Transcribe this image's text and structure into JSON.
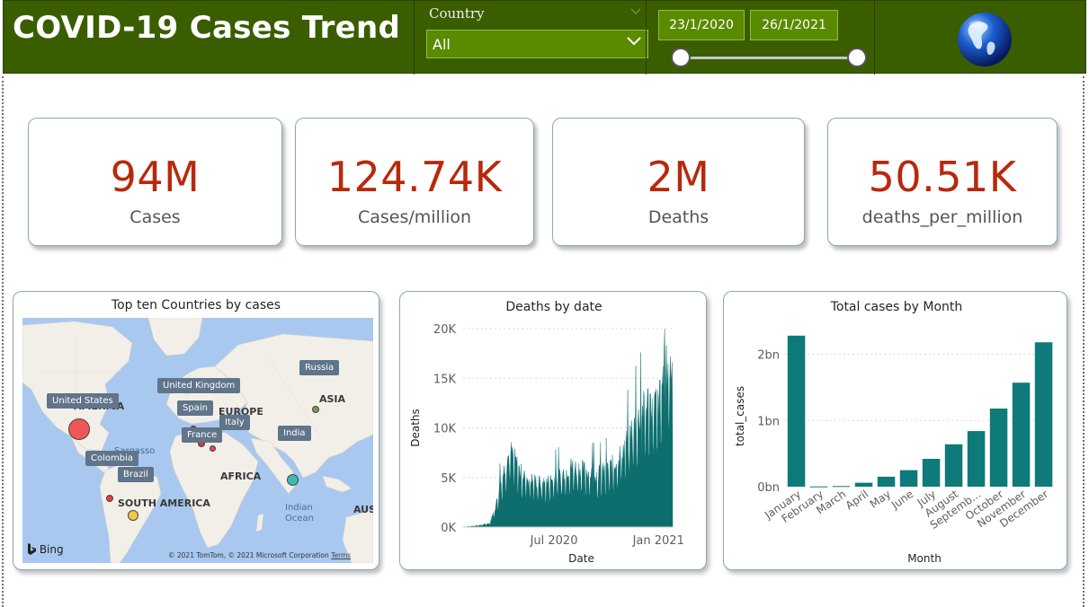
{
  "header": {
    "title": "COVID-19 Cases Trend",
    "country_filter_label": "Country",
    "country_selected": "All",
    "date_start": "23/1/2020",
    "date_end": "26/1/2021",
    "range_value": [
      0,
      1
    ]
  },
  "kpis": [
    {
      "value": "94M",
      "label": "Cases"
    },
    {
      "value": "124.74K",
      "label": "Cases/million"
    },
    {
      "value": "2M",
      "label": "Deaths"
    },
    {
      "value": "50.51K",
      "label": "deaths_per_million"
    }
  ],
  "map_panel": {
    "title": "Top ten Countries by cases",
    "continent_labels": [
      "AMERICA",
      "EUROPE",
      "ASIA",
      "AFRICA",
      "SOUTH AMERICA",
      "AUS"
    ],
    "ocean_labels": [
      "Sargasso Sea",
      "Indian Ocean"
    ],
    "country_tags": [
      "United States",
      "United Kingdom",
      "Spain",
      "Italy",
      "France",
      "Russia",
      "India",
      "Colombia",
      "Brazil"
    ],
    "attribution": "Bing",
    "copyright": "© 2021 TomTom, © 2021 Microsoft Corporation",
    "terms": "Terms",
    "colors": {
      "water": "#a8c8ef",
      "land": "#f2efe9",
      "tag": "#60748a"
    }
  },
  "chart_data": [
    {
      "type": "area",
      "title": "Deaths by date",
      "xlabel": "Date",
      "ylabel": "Deaths",
      "x_ticks": [
        "Jul 2020",
        "Jan 2021"
      ],
      "y_ticks": [
        "0K",
        "5K",
        "10K",
        "15K",
        "20K"
      ],
      "ylim": [
        0,
        20000
      ],
      "xlim": [
        "2020-01-23",
        "2021-01-26"
      ],
      "grid": true,
      "color": "#0e6e6e",
      "series": [
        {
          "x": [
            "2020-01-23",
            "2020-02-08",
            "2020-02-24",
            "2020-03-10",
            "2020-03-20",
            "2020-03-30",
            "2020-04-08",
            "2020-04-16",
            "2020-04-24",
            "2020-05-02",
            "2020-05-10",
            "2020-05-20",
            "2020-06-01",
            "2020-06-15",
            "2020-07-01",
            "2020-07-15",
            "2020-08-01",
            "2020-08-15",
            "2020-09-01",
            "2020-09-15",
            "2020-10-01",
            "2020-10-15",
            "2020-11-01",
            "2020-11-15",
            "2020-12-01",
            "2020-12-15",
            "2021-01-01",
            "2021-01-10",
            "2021-01-20",
            "2021-01-26"
          ],
          "y": [
            0,
            100,
            200,
            400,
            2000,
            4500,
            6500,
            7500,
            6500,
            5500,
            5000,
            4700,
            4500,
            4300,
            4800,
            5200,
            6000,
            5800,
            5400,
            5200,
            5600,
            6200,
            7800,
            9500,
            11000,
            12500,
            12000,
            15000,
            16000,
            15500
          ]
        }
      ]
    },
    {
      "type": "bar",
      "title": "Total cases by Month",
      "xlabel": "Month",
      "ylabel": "total_cases",
      "categories": [
        "January",
        "February",
        "March",
        "April",
        "May",
        "June",
        "July",
        "August",
        "Septemb...",
        "October",
        "November",
        "December"
      ],
      "values": [
        2.28,
        0.004,
        0.01,
        0.06,
        0.15,
        0.25,
        0.42,
        0.64,
        0.84,
        1.18,
        1.57,
        2.18
      ],
      "unit": "bn",
      "y_ticks": [
        "0bn",
        "1bn",
        "2bn"
      ],
      "ylim": [
        0,
        2.4
      ],
      "grid": true,
      "color": "#0e7a7a"
    }
  ]
}
